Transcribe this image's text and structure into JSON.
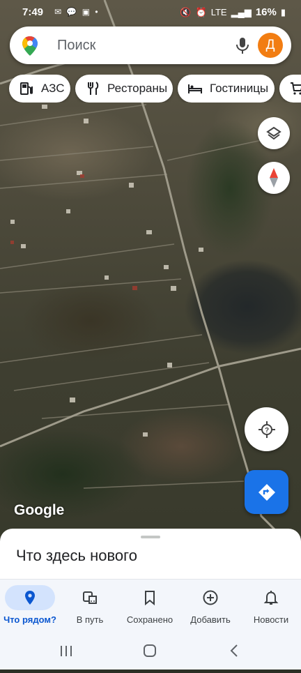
{
  "status_bar": {
    "time": "7:49",
    "notification_icons": [
      "sms-icon",
      "chat-icon",
      "message-icon",
      "dot-icon"
    ],
    "network": "LTE",
    "battery": "16%"
  },
  "search": {
    "placeholder": "Поиск",
    "avatar_letter": "Д",
    "avatar_color": "#f27d12"
  },
  "chips": [
    {
      "label": "АЗС",
      "icon": "gas-station-icon"
    },
    {
      "label": "Рестораны",
      "icon": "restaurant-icon"
    },
    {
      "label": "Гостиницы",
      "icon": "hotel-icon"
    },
    {
      "label": "",
      "icon": "shopping-cart-icon"
    }
  ],
  "map": {
    "attribution": "Google"
  },
  "bottom_sheet": {
    "title": "Что здесь нового"
  },
  "bottom_nav": [
    {
      "label": "Что рядом?",
      "icon": "location-pin-icon",
      "active": true
    },
    {
      "label": "В путь",
      "icon": "commute-icon",
      "active": false
    },
    {
      "label": "Сохранено",
      "icon": "bookmark-icon",
      "active": false
    },
    {
      "label": "Добавить",
      "icon": "add-circle-icon",
      "active": false
    },
    {
      "label": "Новости",
      "icon": "bell-icon",
      "active": false
    }
  ],
  "colors": {
    "accent_blue": "#1a73e8",
    "active_nav_bg": "#d3e3fd"
  }
}
